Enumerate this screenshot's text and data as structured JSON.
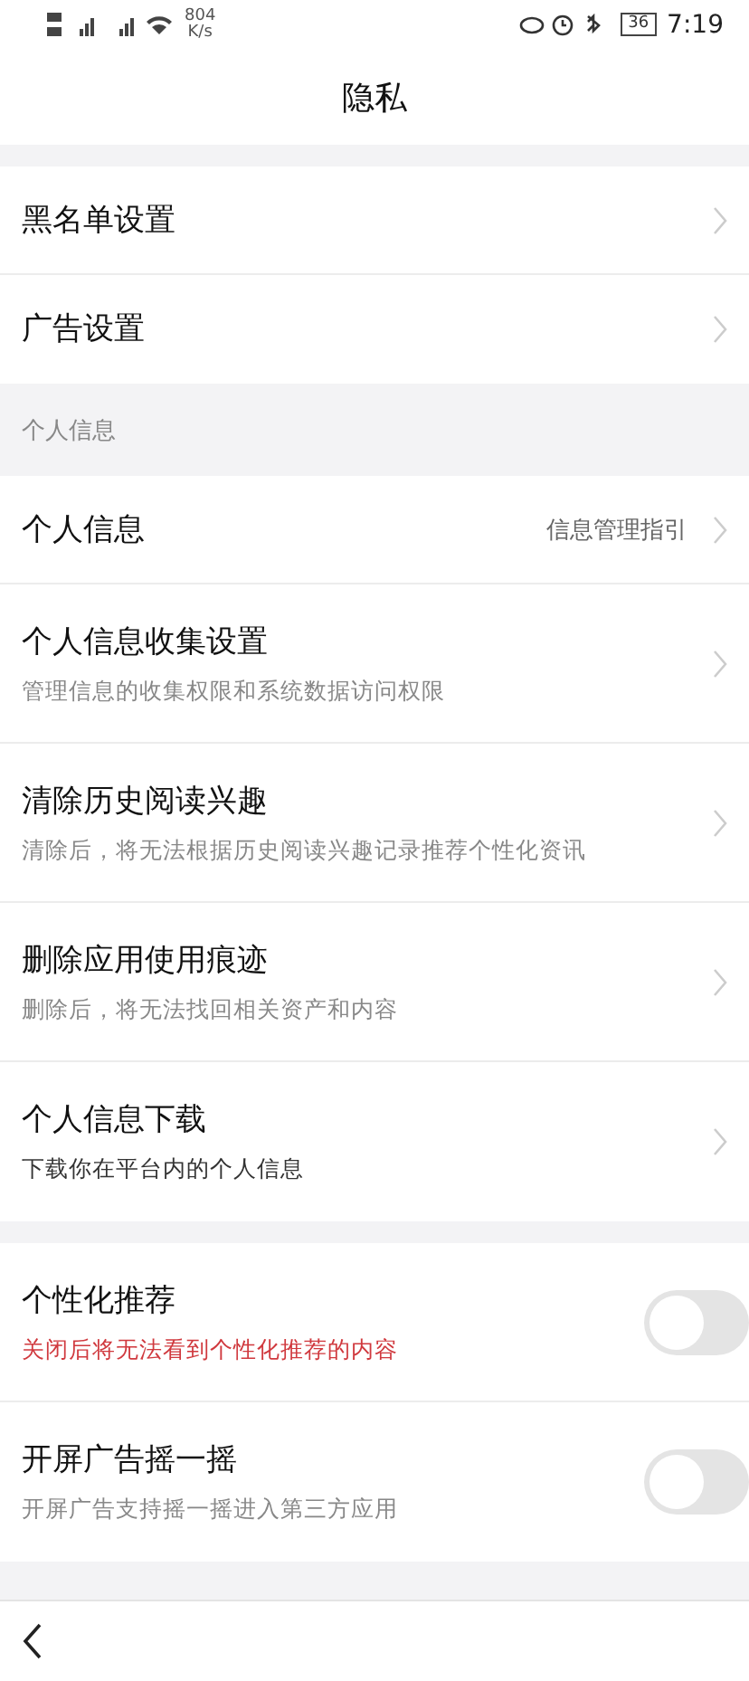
{
  "status_bar": {
    "speed": "804",
    "speed_unit": "K/s",
    "battery": "36",
    "time": "7:19"
  },
  "header": {
    "title": "隐私"
  },
  "groups": [
    {
      "items": [
        {
          "kind": "link",
          "title": "黑名单设置"
        },
        {
          "kind": "link",
          "title": "广告设置"
        }
      ]
    },
    {
      "header": "个人信息",
      "items": [
        {
          "kind": "link",
          "title": "个人信息",
          "value": "信息管理指引"
        },
        {
          "kind": "link",
          "title": "个人信息收集设置",
          "subtitle": "管理信息的收集权限和系统数据访问权限"
        },
        {
          "kind": "link",
          "title": "清除历史阅读兴趣",
          "subtitle": "清除后，将无法根据历史阅读兴趣记录推荐个性化资讯"
        },
        {
          "kind": "link",
          "title": "删除应用使用痕迹",
          "subtitle": "删除后，将无法找回相关资产和内容"
        },
        {
          "kind": "link",
          "title": "个人信息下载",
          "subtitle": "下载你在平台内的个人信息",
          "dark_subtitle": true
        }
      ]
    },
    {
      "items": [
        {
          "kind": "toggle",
          "title": "个性化推荐",
          "subtitle": "关闭后将无法看到个性化推荐的内容",
          "warning": true,
          "on": false
        },
        {
          "kind": "toggle",
          "title": "开屏广告摇一摇",
          "subtitle": "开屏广告支持摇一摇进入第三方应用",
          "on": false
        }
      ]
    }
  ]
}
